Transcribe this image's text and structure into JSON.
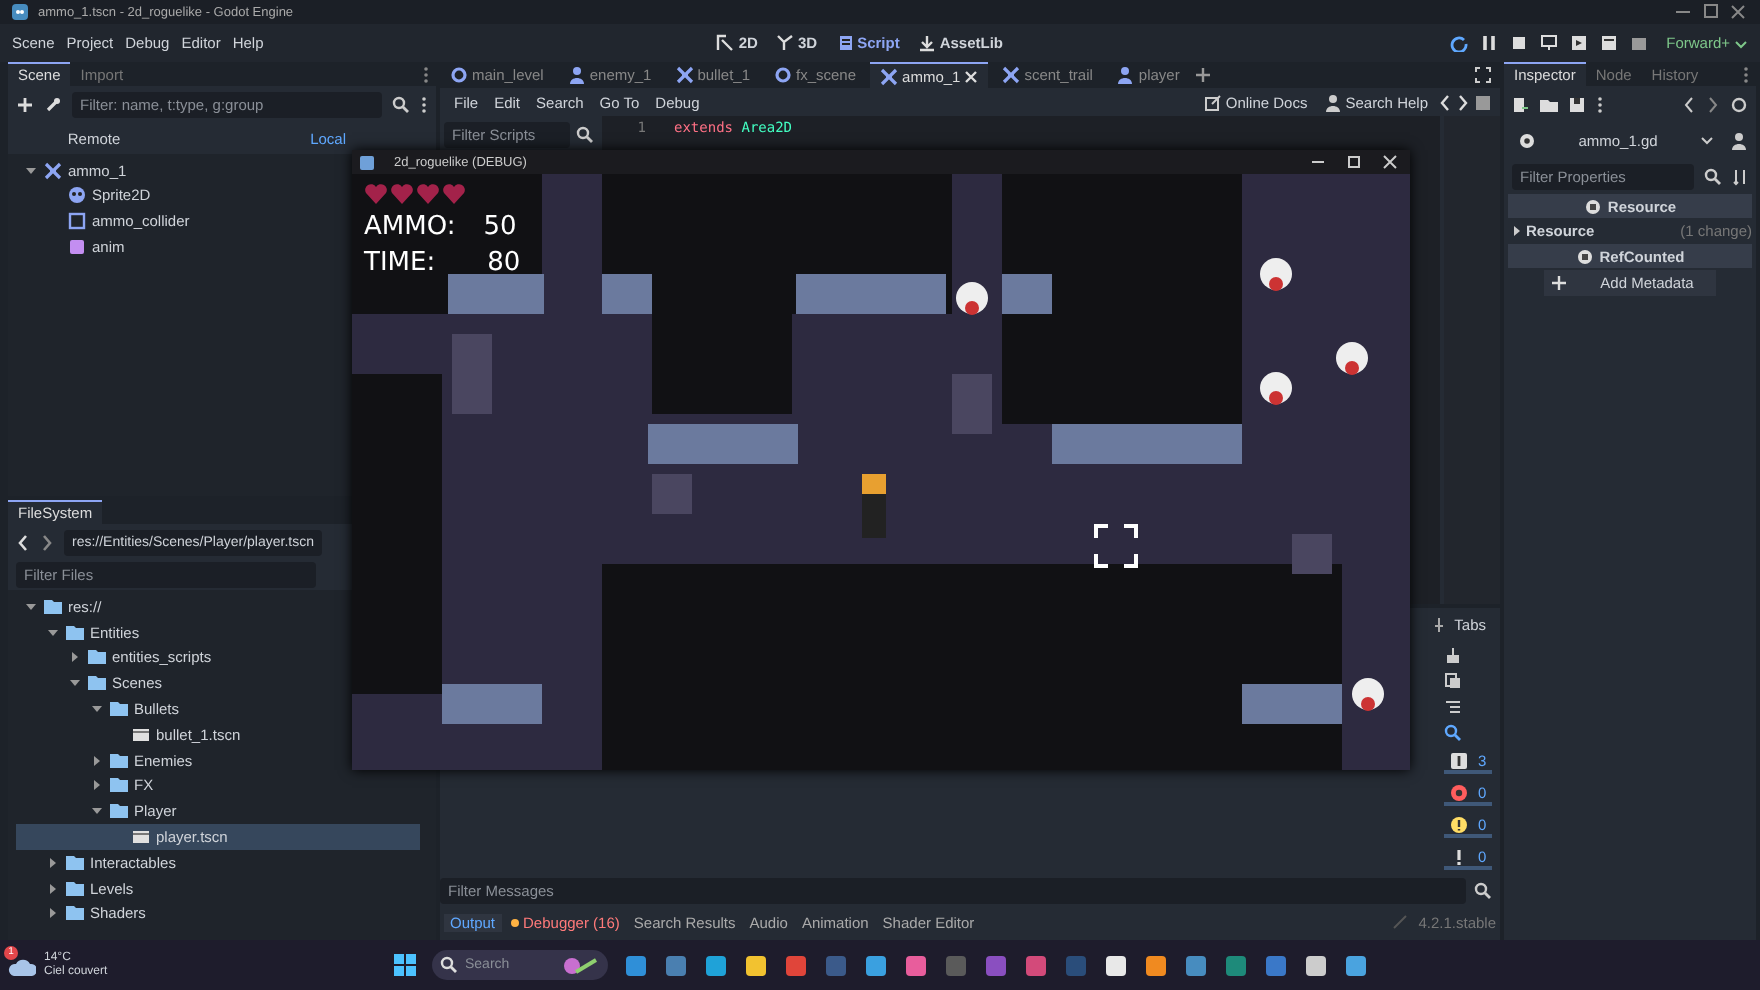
{
  "window": {
    "title": "ammo_1.tscn - 2d_roguelike - Godot Engine"
  },
  "menu": [
    "Scene",
    "Project",
    "Debug",
    "Editor",
    "Help"
  ],
  "workspaces": [
    {
      "label": "2D",
      "kind": "canvas",
      "selected": false
    },
    {
      "label": "3D",
      "kind": "spatial",
      "selected": false
    },
    {
      "label": "Script",
      "kind": "script",
      "selected": true
    },
    {
      "label": "AssetLib",
      "kind": "assetlib",
      "selected": false
    }
  ],
  "renderer": "Forward+",
  "scene_dock": {
    "tabs": [
      {
        "label": "Scene",
        "selected": true
      },
      {
        "label": "Import",
        "selected": false
      }
    ],
    "filter_placeholder": "Filter: name, t:type, g:group",
    "modes": [
      {
        "label": "Remote",
        "selected": false
      },
      {
        "label": "Local",
        "selected": true
      }
    ],
    "tree": [
      {
        "label": "ammo_1",
        "kind": "area",
        "expanded": true,
        "children": [
          {
            "label": "Sprite2D",
            "kind": "sprite"
          },
          {
            "label": "ammo_collider",
            "kind": "collider"
          },
          {
            "label": "anim",
            "kind": "anim"
          }
        ]
      }
    ]
  },
  "filesystem": {
    "title": "FileSystem",
    "path": "res://Entities/Scenes/Player/player.tscn",
    "filter_placeholder": "Filter Files",
    "tree": [
      {
        "label": "res://",
        "kind": "folder",
        "expanded": true,
        "selected": false,
        "children": [
          {
            "label": "Entities",
            "kind": "folder",
            "expanded": true,
            "selected": false,
            "children": [
              {
                "label": "entities_scripts",
                "kind": "folder",
                "expanded": false,
                "selected": false
              },
              {
                "label": "Scenes",
                "kind": "folder",
                "expanded": true,
                "selected": false,
                "children": [
                  {
                    "label": "Bullets",
                    "kind": "folder",
                    "expanded": true,
                    "selected": false,
                    "children": [
                      {
                        "label": "bullet_1.tscn",
                        "kind": "file",
                        "selected": false
                      }
                    ]
                  },
                  {
                    "label": "Enemies",
                    "kind": "folder",
                    "expanded": false,
                    "selected": false
                  },
                  {
                    "label": "FX",
                    "kind": "folder",
                    "expanded": false,
                    "selected": false
                  },
                  {
                    "label": "Player",
                    "kind": "folder",
                    "expanded": true,
                    "selected": false,
                    "children": [
                      {
                        "label": "player.tscn",
                        "kind": "file",
                        "selected": true
                      }
                    ]
                  }
                ]
              }
            ]
          },
          {
            "label": "Interactables",
            "kind": "folder",
            "expanded": false,
            "selected": false
          },
          {
            "label": "Levels",
            "kind": "folder",
            "expanded": false,
            "selected": false
          },
          {
            "label": "Shaders",
            "kind": "folder",
            "expanded": false,
            "selected": false
          }
        ]
      }
    ]
  },
  "script_tabs": [
    {
      "label": "main_level",
      "kind": "node",
      "selected": false
    },
    {
      "label": "enemy_1",
      "kind": "character",
      "selected": false
    },
    {
      "label": "bullet_1",
      "kind": "area",
      "selected": false
    },
    {
      "label": "fx_scene",
      "kind": "node",
      "selected": false
    },
    {
      "label": "ammo_1",
      "kind": "area",
      "selected": true
    },
    {
      "label": "scent_trail",
      "kind": "area",
      "selected": false
    },
    {
      "label": "player",
      "kind": "character",
      "selected": false
    }
  ],
  "script_menu": [
    "File",
    "Edit",
    "Search",
    "Go To",
    "Debug"
  ],
  "help_links": [
    "Online Docs",
    "Search Help"
  ],
  "scripts_filter_placeholder": "Filter Scripts",
  "code": [
    {
      "line": "1",
      "keyword": "extends",
      "type": "Area2D"
    }
  ],
  "game_window": {
    "title": "2d_roguelike (DEBUG)",
    "hearts": [
      {
        "filled": true
      },
      {
        "filled": true
      },
      {
        "filled": true
      },
      {
        "filled": true
      }
    ],
    "hud": [
      {
        "label": "AMMO:",
        "value": "50"
      },
      {
        "label": "TIME:",
        "value": "80"
      }
    ]
  },
  "inspector": {
    "tabs": [
      {
        "label": "Inspector",
        "selected": true
      },
      {
        "label": "Node",
        "selected": false
      },
      {
        "label": "History",
        "selected": false
      }
    ],
    "resource": "ammo_1.gd",
    "filter_placeholder": "Filter Properties",
    "rows": [
      {
        "kind": "header",
        "label": "Resource"
      },
      {
        "kind": "property",
        "label": "Resource",
        "value": "(1 change)"
      },
      {
        "kind": "header",
        "label": "RefCounted"
      },
      {
        "kind": "button",
        "label": "Add Metadata"
      }
    ]
  },
  "bottom_panel": {
    "tabs_toggle": "Tabs",
    "counters": [
      {
        "kind": "info",
        "count": "3"
      },
      {
        "kind": "error",
        "count": "0"
      },
      {
        "kind": "warning",
        "count": "0"
      },
      {
        "kind": "debug",
        "count": "0"
      }
    ],
    "filter_placeholder": "Filter Messages",
    "tabs": [
      {
        "label": "Output",
        "kind": "plain",
        "selected": true
      },
      {
        "label": "Debugger (16)",
        "kind": "alert",
        "selected": false
      },
      {
        "label": "Search Results",
        "kind": "plain",
        "selected": false
      },
      {
        "label": "Audio",
        "kind": "plain",
        "selected": false
      },
      {
        "label": "Animation",
        "kind": "plain",
        "selected": false
      },
      {
        "label": "Shader Editor",
        "kind": "plain",
        "selected": false
      }
    ],
    "version": "4.2.1.stable"
  },
  "taskbar": {
    "weather": {
      "badge": "1",
      "temperature": "14°C",
      "condition": "Ciel couvert"
    },
    "search_placeholder": "Search",
    "apps": [
      {
        "color": "#2f8fd8"
      },
      {
        "color": "#4a7fb0"
      },
      {
        "color": "#1fa2d8"
      },
      {
        "color": "#f2c230"
      },
      {
        "color": "#e0453a"
      },
      {
        "color": "#3b5a8a"
      },
      {
        "color": "#3aa0e0"
      },
      {
        "color": "#e85d9c"
      },
      {
        "color": "#5a5a5a"
      },
      {
        "color": "#8a4fc0"
      },
      {
        "color": "#d34a7a"
      },
      {
        "color": "#2a4d7a"
      },
      {
        "color": "#e8e8e8"
      },
      {
        "color": "#f08a20"
      },
      {
        "color": "#478cbf"
      },
      {
        "color": "#1e8a7a"
      },
      {
        "color": "#3a78c8"
      },
      {
        "color": "#cccccc"
      },
      {
        "color": "#4aa3df"
      }
    ]
  }
}
